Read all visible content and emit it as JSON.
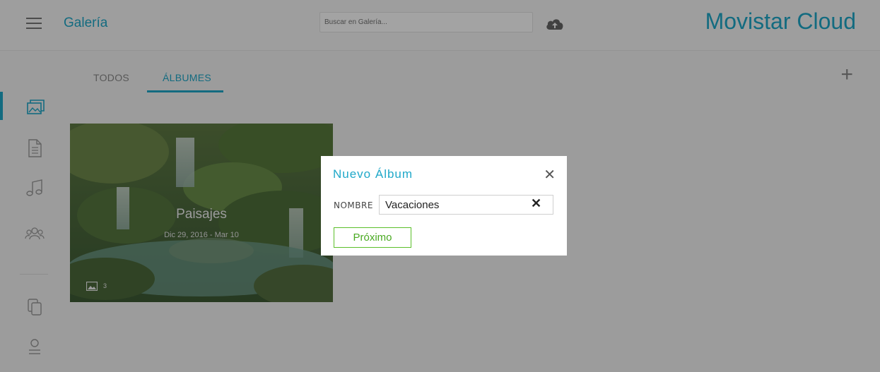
{
  "header": {
    "title": "Galería",
    "search_placeholder": "Buscar en Galería...",
    "brand": "Movistar Cloud"
  },
  "tabs": [
    {
      "label": "TODOS"
    },
    {
      "label": "ÁLBUMES"
    }
  ],
  "album": {
    "title": "Paisajes",
    "dates": "Dic 29, 2016 - Mar 10",
    "count": "3"
  },
  "dialog": {
    "title": "Nuevo Álbum",
    "field_label": "NOMBRE",
    "field_value": "Vacaciones",
    "next_label": "Próximo"
  },
  "colors": {
    "accent": "#1fa8c9",
    "button_green": "#5bbf2a"
  },
  "icons": {
    "menu": "menu-icon",
    "upload": "cloud-upload-icon",
    "add": "plus-icon",
    "rail": [
      "photos-icon",
      "document-icon",
      "music-icon",
      "contacts-icon",
      "copy-icon",
      "profile-icon"
    ],
    "close": "close-icon",
    "clear": "clear-icon"
  }
}
